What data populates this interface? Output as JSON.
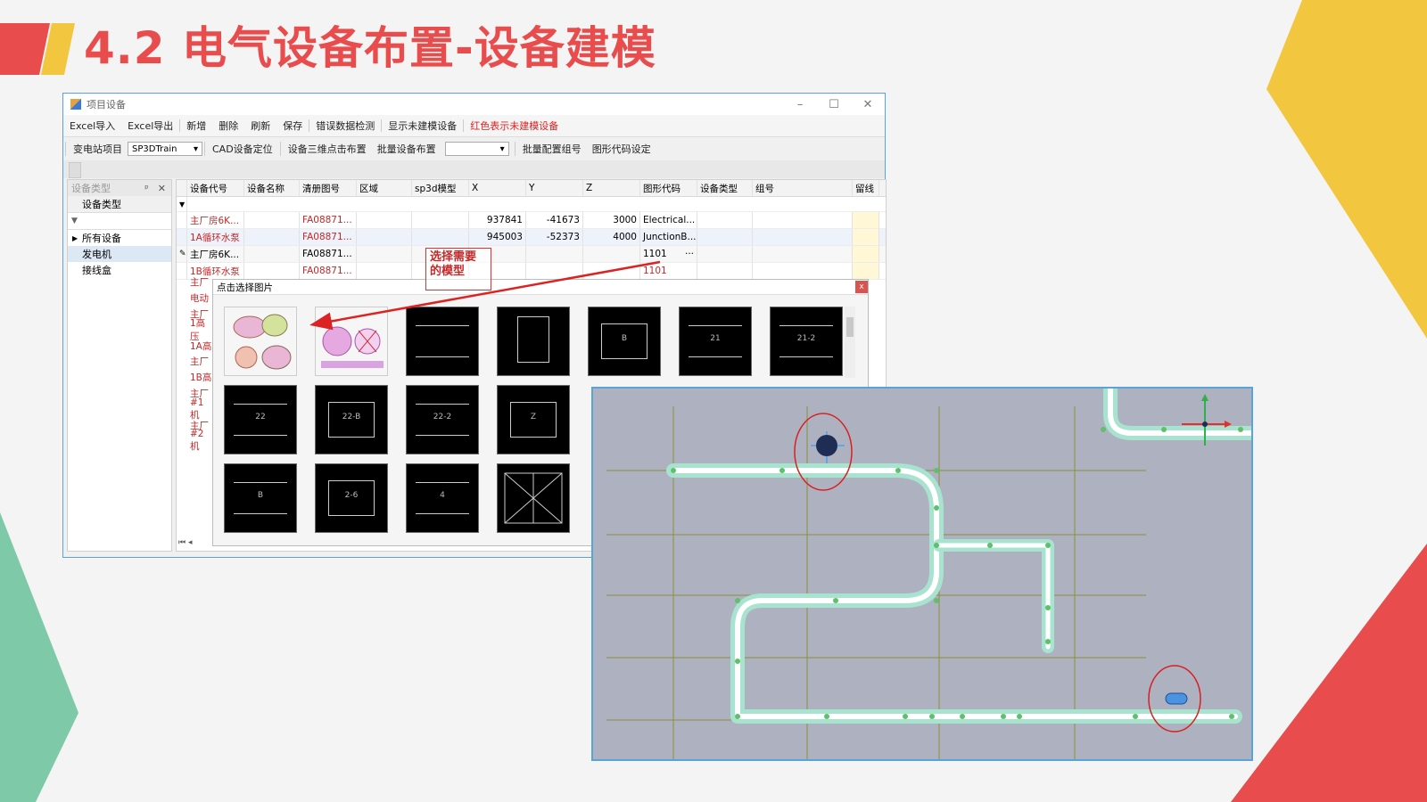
{
  "slide": {
    "title": "4.2 电气设备布置-设备建模"
  },
  "window": {
    "title": "项目设备",
    "controls": [
      "–",
      "☐",
      "✕"
    ],
    "menu": [
      "Excel导入",
      "Excel导出",
      "新增",
      "删除",
      "刷新",
      "保存",
      "错误数据检测",
      "显示未建模设备",
      "红色表示未建模设备"
    ],
    "toolbar": {
      "substation_label": "变电站项目",
      "train_value": "SP3DTrain",
      "items": [
        "CAD设备定位",
        "设备三维点击布置",
        "批量设备布置"
      ],
      "combo_value": "",
      "items2": [
        "批量配置组号",
        "图形代码设定"
      ]
    }
  },
  "left_panel": {
    "header": "设备类型",
    "pin": "ᵖ",
    "close": "✕",
    "column": "设备类型",
    "filter": "▼",
    "items": [
      "所有设备",
      "发电机",
      "接线盒"
    ]
  },
  "grid": {
    "columns": [
      "设备代号",
      "设备名称",
      "清册图号",
      "区域",
      "sp3d模型",
      "X",
      "Y",
      "Z",
      "图形代码",
      "设备类型",
      "组号",
      "留线"
    ],
    "filter_icon": "▼",
    "rows": [
      {
        "code": "主厂房6K...",
        "name": "",
        "drawing": "FA08871...",
        "area": "",
        "model": "",
        "x": "937841",
        "y": "-41673",
        "z": "3000",
        "shape": "Electrical...",
        "red": true
      },
      {
        "code": "1A循环水泵",
        "name": "",
        "drawing": "FA08871...",
        "area": "",
        "model": "",
        "x": "945003",
        "y": "-52373",
        "z": "4000",
        "shape": "JunctionB...",
        "red": true
      },
      {
        "code": "主厂房6K...",
        "name": "",
        "drawing": "FA08871...",
        "area": "",
        "model": "",
        "x": "",
        "y": "",
        "z": "",
        "shape": "1101",
        "red": false
      },
      {
        "code": "1B循环水泵",
        "name": "",
        "drawing": "FA08871...",
        "area": "",
        "model": "",
        "x": "",
        "y": "",
        "z": "",
        "shape": "1101",
        "red": true
      }
    ],
    "hidden_rows": [
      "主厂",
      "电动",
      "主厂",
      "1高压",
      "1A高",
      "主厂",
      "1B高",
      "主厂",
      "#1机",
      "主厂",
      "#2机"
    ],
    "edit_dots": "···",
    "pencil": "✎",
    "nav": "⏮ ◂"
  },
  "popup": {
    "title": "点击选择图片",
    "close": "x",
    "thumbs_row1": [
      "",
      "",
      "",
      "",
      "B",
      "21",
      "21-2"
    ],
    "thumbs_row2": [
      "22",
      "22-B",
      "22-2",
      "Z"
    ],
    "thumbs_row3": [
      "B",
      "2-6",
      "4",
      ""
    ]
  },
  "annotation": {
    "text": "选择需要的模型"
  }
}
